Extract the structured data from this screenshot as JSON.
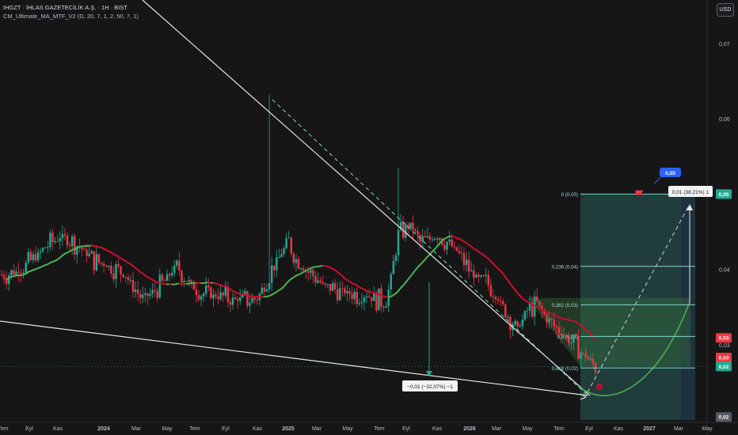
{
  "header": {
    "title": "IHGZT · İHLAS GAZETECİLİK A.Ş. · 1H · BIST",
    "indicator": "CM_Ultimate_MA_MTF_V2 (D, 20, 7, 1, 2, 50, 7, 1)",
    "currency_button": "USD"
  },
  "colors": {
    "background": "#161616",
    "up_candle": "#22ab94",
    "down_candle": "#f23645",
    "ma_up": "#4caf50",
    "ma_down": "#c8102e",
    "trendline": "#e6e6e6",
    "fib_line": "#7fd6cf",
    "target_zone": "#2e6e6a",
    "accent_badge": "#2962ff"
  },
  "chart_data": {
    "type": "candlestick",
    "x_ticks": [
      "Tem",
      "Eyl",
      "Kas",
      "2024",
      "Mar",
      "May",
      "Tem",
      "Eyl",
      "Kas",
      "2025",
      "Mar",
      "May",
      "Tem",
      "Eyl",
      "Kas",
      "2026",
      "Mar",
      "May",
      "Tem",
      "Eyl",
      "Kas",
      "2027",
      "Mar",
      "May"
    ],
    "y_ticks": [
      "0,07",
      "0,06",
      "0,05",
      "0,04",
      "0,03",
      "0,02"
    ],
    "ylim": [
      0.0195,
      0.0747
    ],
    "price_badges": [
      {
        "label": "0,05",
        "value": 0.05,
        "color": "#22ab94"
      },
      {
        "label": "0,03",
        "value": 0.0309,
        "color": "#f23645"
      },
      {
        "label": "0,03",
        "value": 0.0283,
        "color": "#f23645"
      },
      {
        "label": "0,02",
        "value": 0.0271,
        "color": "#22ab94"
      },
      {
        "label": "0,02",
        "value": 0.0204,
        "color": "#555a63"
      }
    ],
    "fib_levels": [
      {
        "label": "0 (0,05)",
        "value": 0.05
      },
      {
        "label": "0,236 (0,04)",
        "value": 0.0404
      },
      {
        "label": "0,382 (0,03)",
        "value": 0.0353
      },
      {
        "label": "0,5 (0,03)",
        "value": 0.0311
      },
      {
        "label": "0,618 (0,02)",
        "value": 0.0269
      }
    ],
    "measure_down_label": "−0,01 (−32,07%) −1",
    "measure_up_label": "0,01 (38,21%) 1",
    "target_badge": "0,05",
    "bars_in_chart": 245
  }
}
